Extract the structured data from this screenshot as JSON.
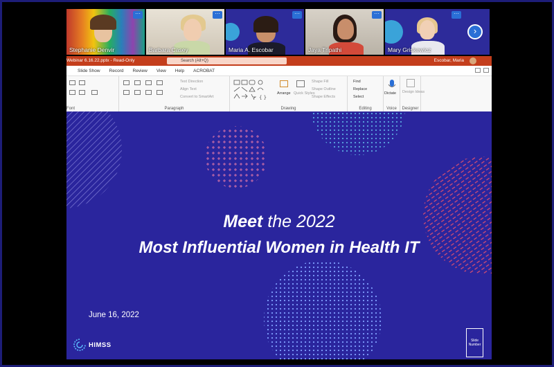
{
  "participants": [
    {
      "name": "Stephanie Denvir"
    },
    {
      "name": "Barbara Casey"
    },
    {
      "name": "Maria A. Escobar"
    },
    {
      "name": "Jaya Tripathi"
    },
    {
      "name": "Mary Griskewicz"
    }
  ],
  "more_label": "···",
  "next_label": "›",
  "ppt": {
    "filename": "Webinar 6.16.22.pptx - Read-Only",
    "search_placeholder": "Search (Alt+Q)",
    "user": "Escobar, Maria",
    "menu": [
      "Slide Show",
      "Record",
      "Review",
      "View",
      "Help",
      "ACROBAT"
    ],
    "ribbon": {
      "font_label": "Font",
      "paragraph_label": "Paragraph",
      "drawing_label": "Drawing",
      "editing_label": "Editing",
      "voice_label": "Voice",
      "designer_label": "Designer",
      "text_direction": "Text Direction",
      "align_text": "Align Text",
      "convert_smartart": "Convert to SmartArt",
      "arrange": "Arrange",
      "quick_styles": "Quick Styles",
      "shape_fill": "Shape Fill",
      "shape_outline": "Shape Outline",
      "shape_effects": "Shape Effects",
      "find": "Find",
      "replace": "Replace",
      "select": "Select",
      "dictate": "Dictate",
      "design_ideas": "Design Ideas"
    }
  },
  "slide": {
    "title_meet": "Meet",
    "title_rest": "the 2022",
    "title_line2": "Most Influential Women in Health IT",
    "date": "June 16, 2022",
    "logo_text": "HIMSS",
    "slide_number_label": "Slide Number"
  },
  "colors": {
    "slide_bg": "#2a259d",
    "ppt_accent": "#c43e1c",
    "zoom_blue": "#2a6fd6"
  }
}
